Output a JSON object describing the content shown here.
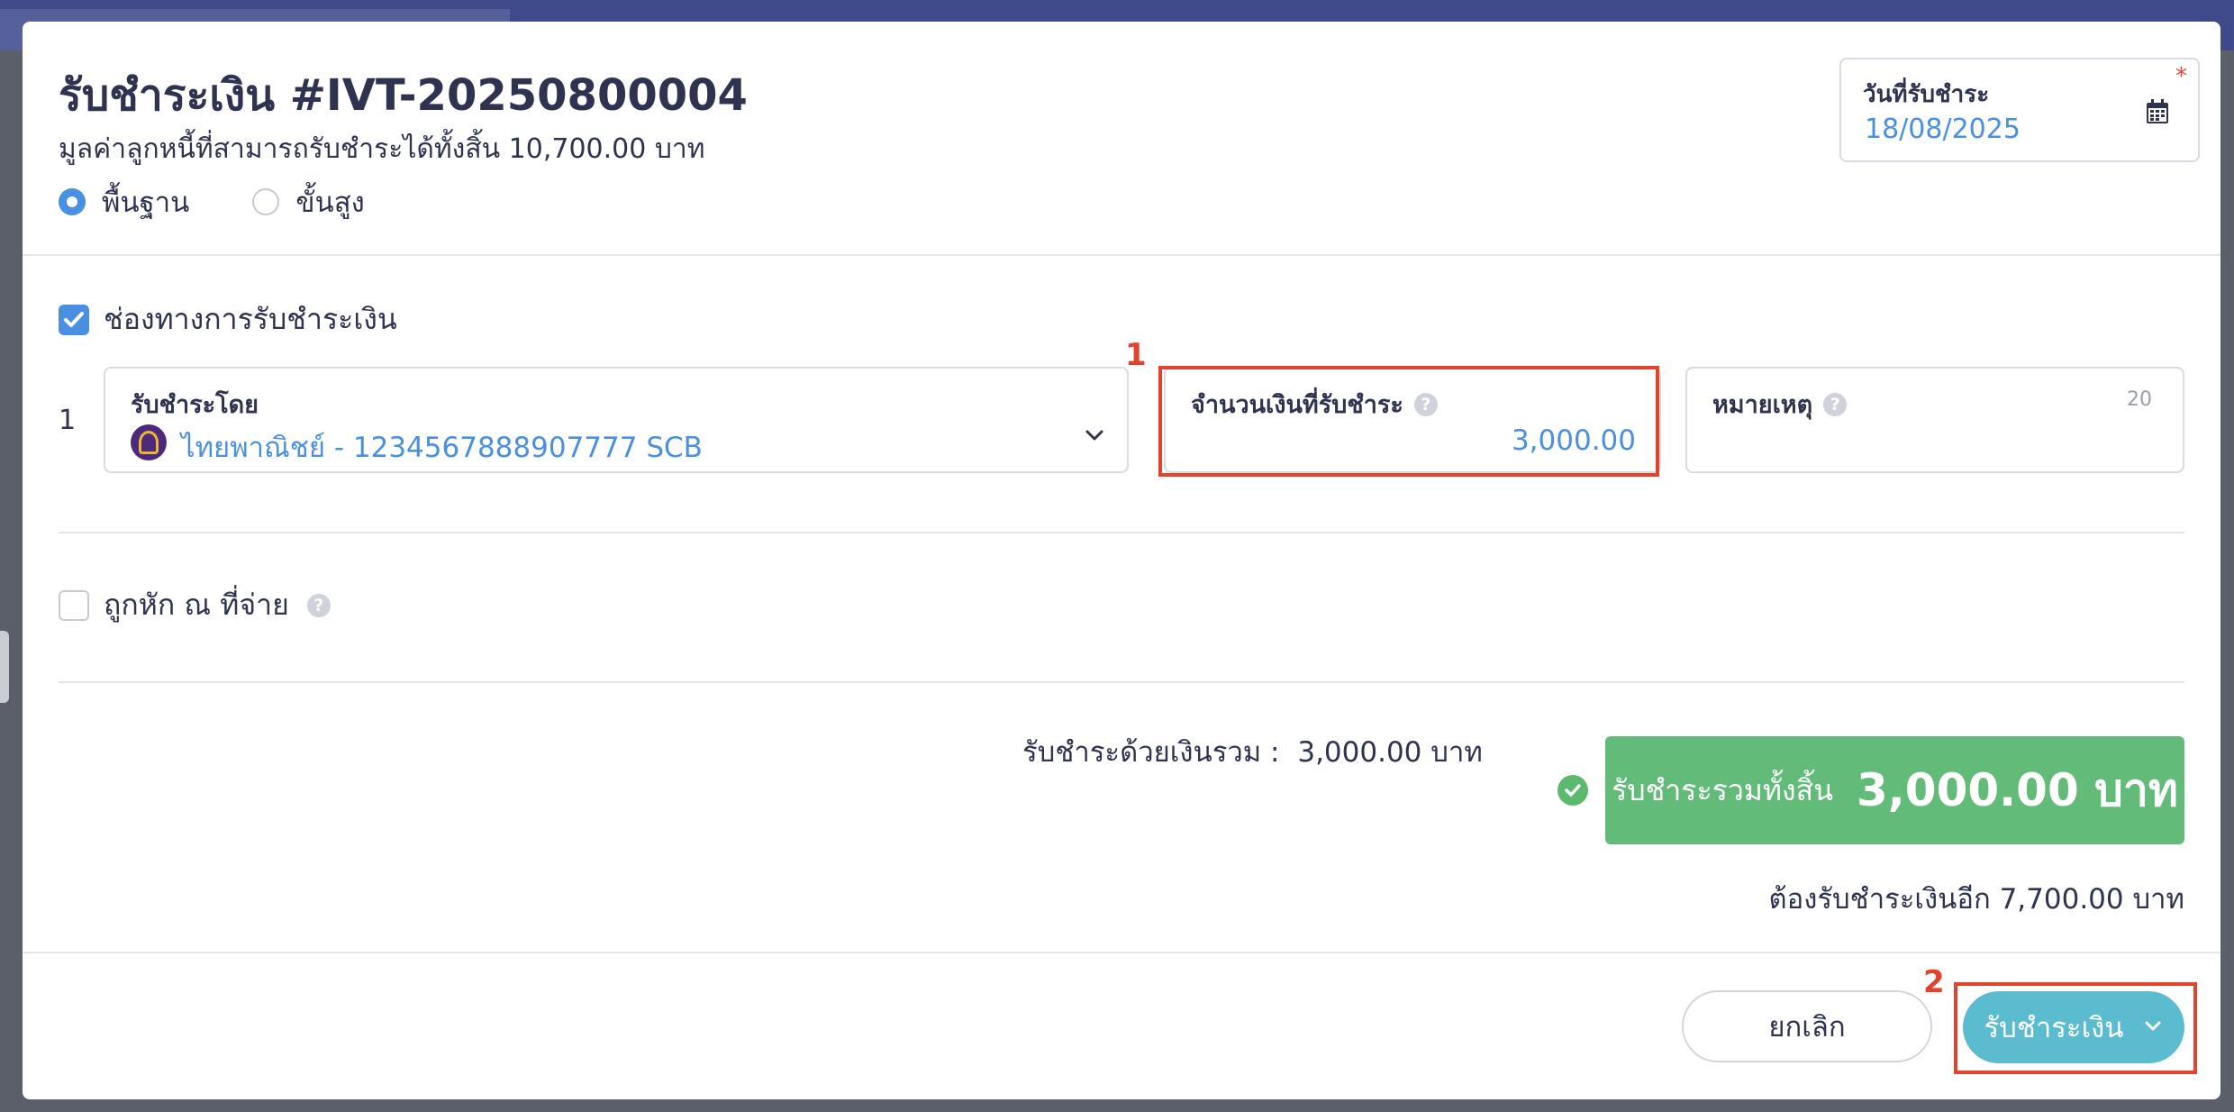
{
  "header": {
    "title": "รับชำระเงิน #IVT-20250800004",
    "subtitle": "มูลค่าลูกหนี้ที่สามารถรับชำระได้ทั้งสิ้น 10,700.00 บาท",
    "mode_basic": "พื้นฐาน",
    "mode_advanced": "ขั้นสูง",
    "selected_mode": "พื้นฐาน"
  },
  "date_field": {
    "label": "วันที่รับชำระ",
    "value": "18/08/2025",
    "required_mark": "*"
  },
  "payment_channel": {
    "checkbox_label": "ช่องทางการรับชำระเงิน",
    "checked": true,
    "rows": [
      {
        "index": "1",
        "method_label": "รับชำระโดย",
        "method_value": "ไทยพาณิชย์ - 1234567888907777 SCB",
        "amount_label": "จำนวนเงินที่รับชำระ",
        "amount_value": "3,000.00",
        "note_label": "หมายเหตุ",
        "note_counter": "20"
      }
    ]
  },
  "withholding": {
    "checkbox_label": "ถูกหัก ณ ที่จ่าย",
    "checked": false
  },
  "summary": {
    "cash_total_label": "รับชำระด้วยเงินรวม :",
    "cash_total_value": "3,000.00 บาท",
    "grand_total_label": "รับชำระรวมทั้งสิ้น",
    "grand_total_value": "3,000.00 บาท",
    "remaining_text": "ต้องรับชำระเงินอีก 7,700.00 บาท"
  },
  "footer": {
    "cancel_label": "ยกเลิก",
    "submit_label": "รับชำระเงิน"
  },
  "annotations": {
    "marker_1": "1",
    "marker_2": "2"
  },
  "colors": {
    "accent_blue": "#4a90e2",
    "success_green": "#63bb79",
    "submit_teal": "#5bbcd0",
    "highlight_red": "#e0442d"
  },
  "icons": [
    "calendar-icon",
    "chevron-down-icon",
    "help-icon",
    "check-circle-icon",
    "scb-bank-logo"
  ]
}
